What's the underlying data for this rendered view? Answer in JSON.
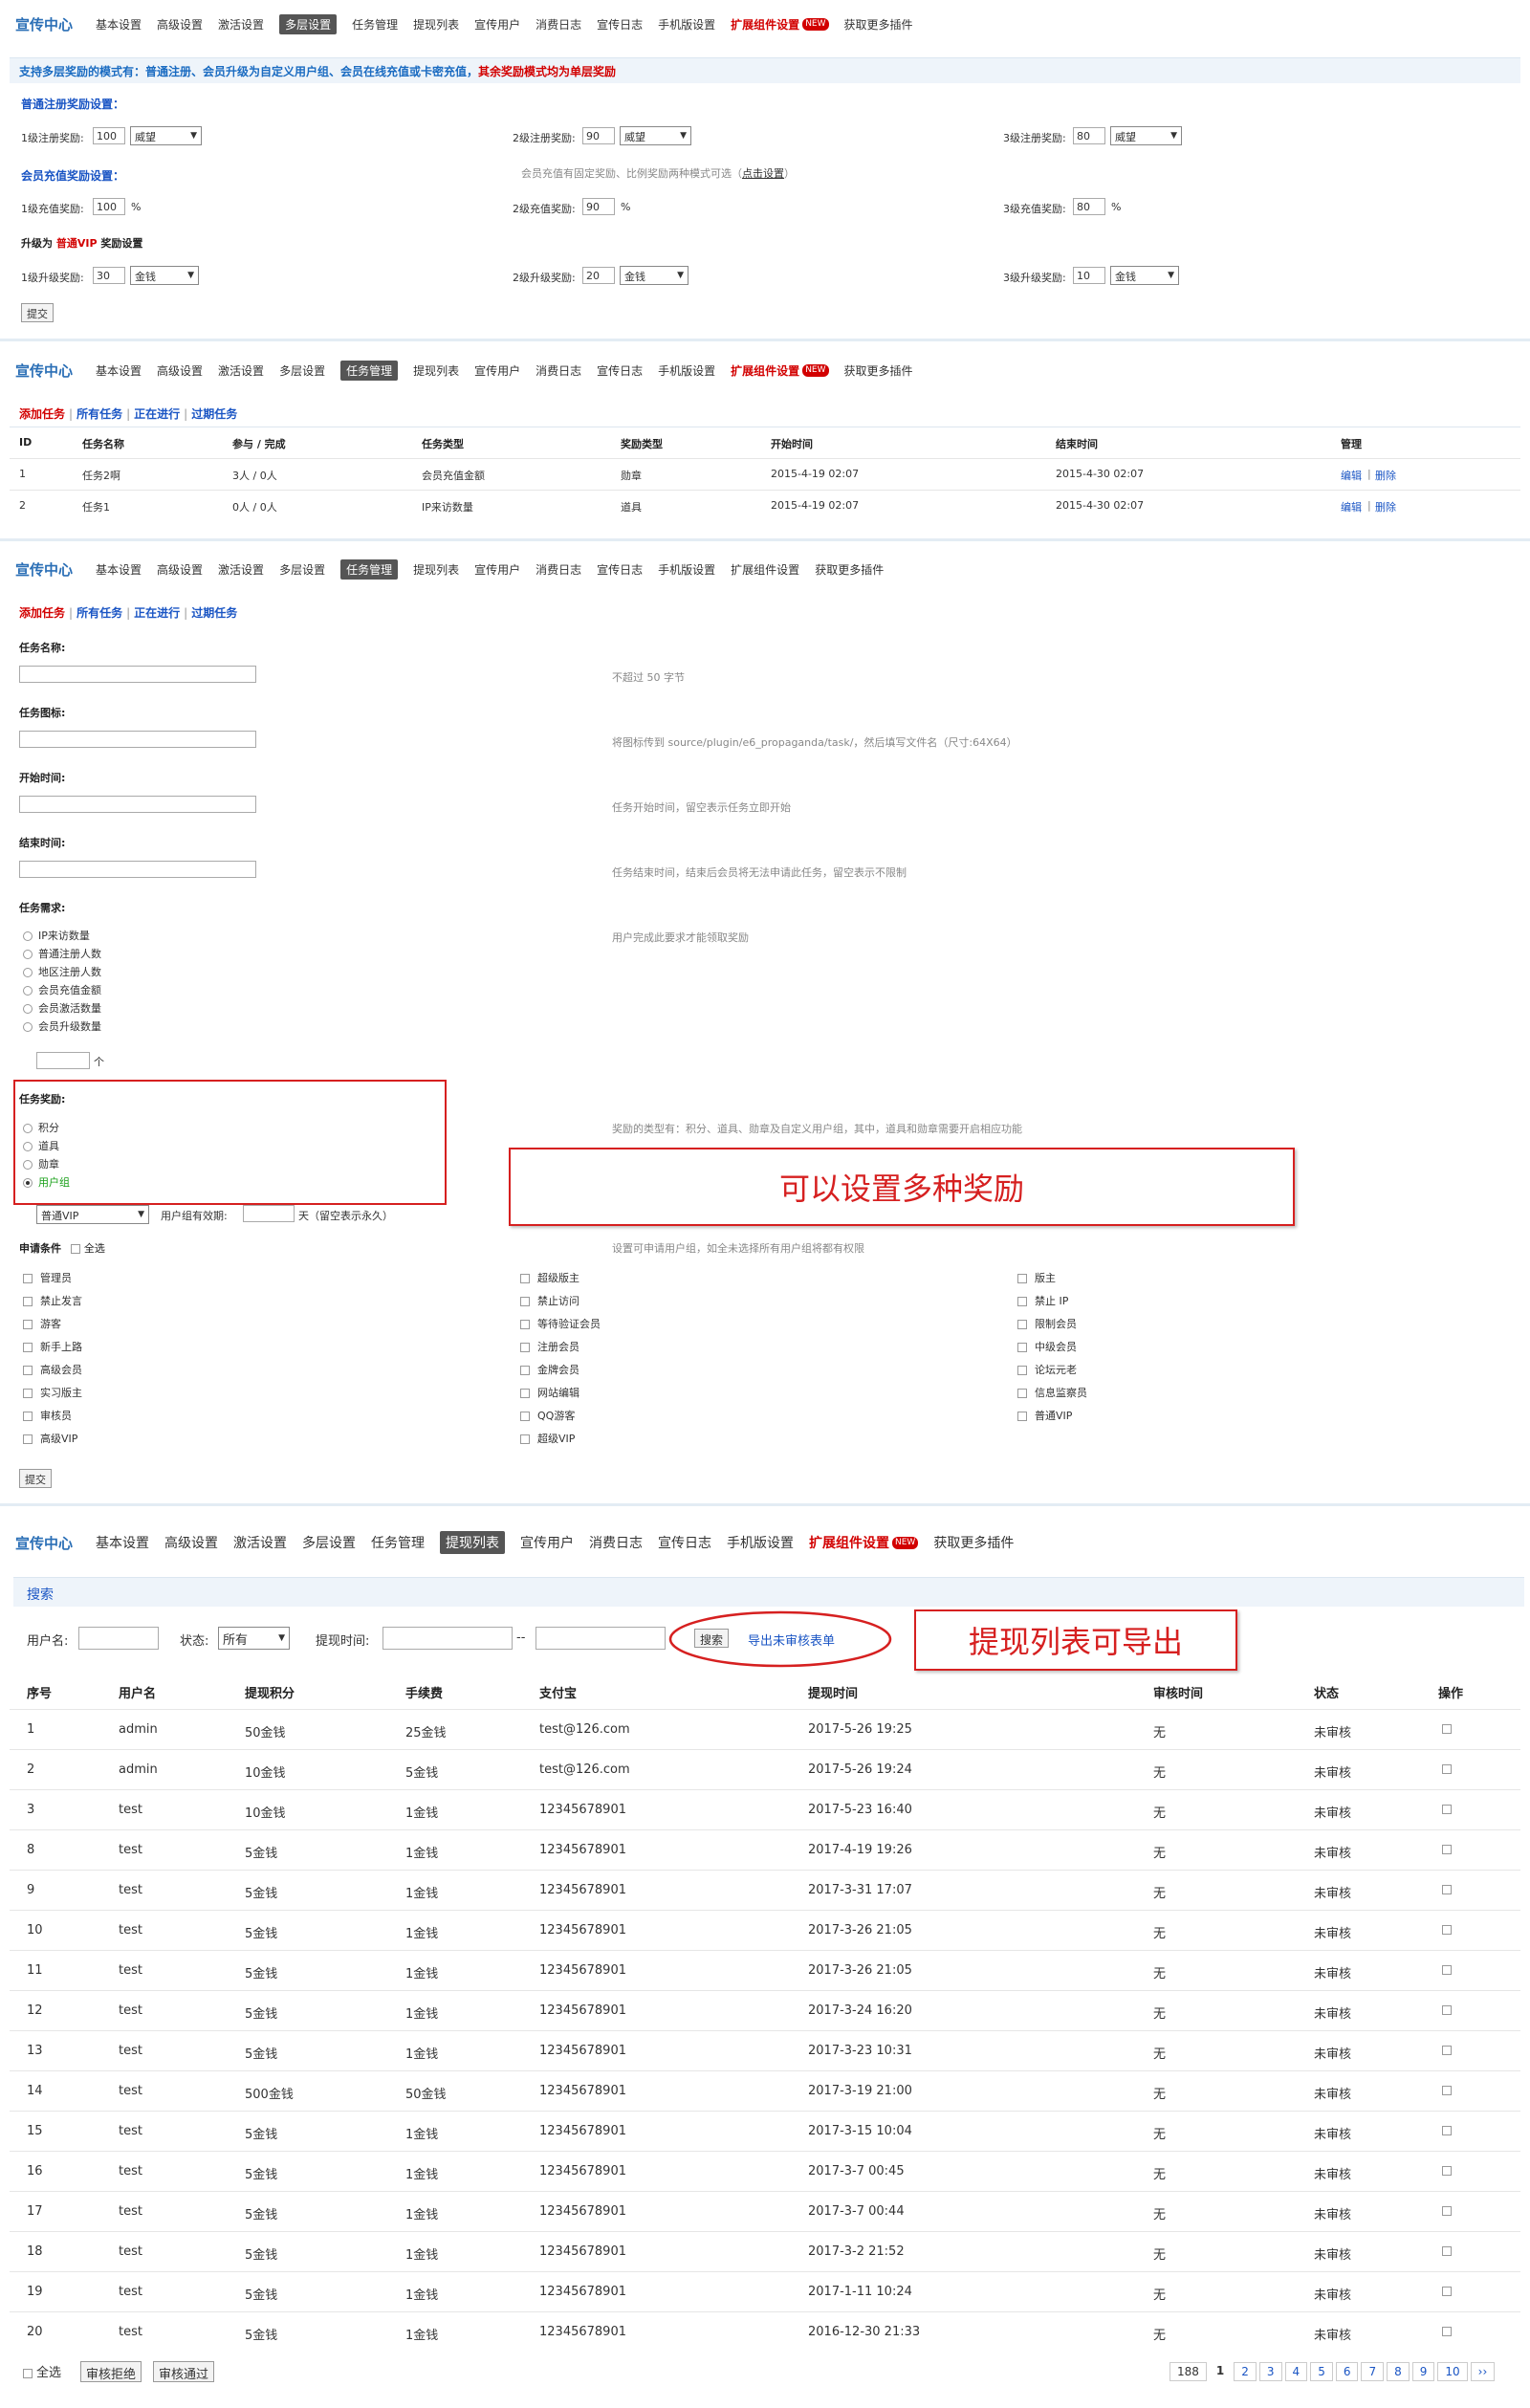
{
  "nav1": {
    "brand": "宣传中心",
    "items": [
      "基本设置",
      "高级设置",
      "激活设置",
      "多层设置",
      "任务管理",
      "提现列表",
      "宣传用户",
      "消费日志",
      "宣传日志",
      "手机版设置",
      "扩展组件设置",
      "获取更多插件"
    ],
    "hot": "NEW"
  },
  "multilayer": {
    "info_prefix": "支持多层奖励的模式有：普通注册、会员升级为自定义用户组、会员在线充值或卡密充值，",
    "info_suffix": "其余奖励模式均为单层奖励",
    "normal_title": "普通注册奖励设置：",
    "reg": [
      {
        "label": "1级注册奖励:",
        "value": "100",
        "unit": "威望"
      },
      {
        "label": "2级注册奖励:",
        "value": "90",
        "unit": "威望"
      },
      {
        "label": "3级注册奖励:",
        "value": "80",
        "unit": "威望"
      }
    ],
    "recharge_title": "会员充值奖励设置：",
    "recharge_note_a": "会员充值有固定奖励、比例奖励两种模式可选（",
    "recharge_note_link": "点击设置",
    "recharge_note_b": "）",
    "recharge": [
      {
        "label": "1级充值奖励:",
        "value": "100",
        "unit": "%"
      },
      {
        "label": "2级充值奖励:",
        "value": "90",
        "unit": "%"
      },
      {
        "label": "3级充值奖励:",
        "value": "80",
        "unit": "%"
      }
    ],
    "upgrade_a": "升级为",
    "upgrade_group": "普通VIP",
    "upgrade_b": "奖励设置",
    "upgrade": [
      {
        "label": "1级升级奖励:",
        "value": "30",
        "unit": "金钱"
      },
      {
        "label": "2级升级奖励:",
        "value": "20",
        "unit": "金钱"
      },
      {
        "label": "3级升级奖励:",
        "value": "10",
        "unit": "金钱"
      }
    ],
    "submit": "提交"
  },
  "tasks": {
    "tabs": [
      "添加任务",
      "所有任务",
      "正在进行",
      "过期任务"
    ],
    "headers": [
      "ID",
      "任务名称",
      "参与 / 完成",
      "任务类型",
      "奖励类型",
      "开始时间",
      "结束时间",
      "管理"
    ],
    "rows": [
      [
        "1",
        "任务2啊",
        "3人 / 0人",
        "会员充值金额",
        "勋章",
        "2015-4-19 02:07",
        "2015-4-30 02:07"
      ],
      [
        "2",
        "任务1",
        "0人 / 0人",
        "IP来访数量",
        "道具",
        "2015-4-19 02:07",
        "2015-4-30 02:07"
      ]
    ],
    "edit": "编辑",
    "delete": "删除",
    "sep": "|"
  },
  "form": {
    "name_label": "任务名称:",
    "name_hint": "不超过 50 字节",
    "icon_label": "任务图标:",
    "icon_hint": "将图标传到 source/plugin/e6_propaganda/task/，然后填写文件名（尺寸:64X64）",
    "start_label": "开始时间:",
    "start_hint": "任务开始时间，留空表示任务立即开始",
    "end_label": "结束时间:",
    "end_hint": "任务结束时间，结束后会员将无法申请此任务，留空表示不限制",
    "req_label": "任务需求:",
    "req_hint": "用户完成此要求才能领取奖励",
    "req_options": [
      "IP来访数量",
      "普通注册人数",
      "地区注册人数",
      "会员充值金额",
      "会员激活数量",
      "会员升级数量"
    ],
    "req_unit": "个",
    "reward_label": "任务奖励:",
    "reward_hint": "奖励的类型有：积分、道具、勋章及自定义用户组，其中，道具和勋章需要开启相应功能",
    "reward_options": [
      "积分",
      "道具",
      "勋章",
      "用户组"
    ],
    "reward_group": "普通VIP",
    "reward_valid_label": "用户组有效期:",
    "reward_valid_unit": "天（留空表示永久）",
    "apply_label": "申请条件",
    "apply_all": "全选",
    "apply_hint": "设置可申请用户组，如全未选择所有用户组将都有权限",
    "groups": [
      [
        "管理员",
        "超级版主",
        "版主"
      ],
      [
        "禁止发言",
        "禁止访问",
        "禁止 IP"
      ],
      [
        "游客",
        "等待验证会员",
        "限制会员"
      ],
      [
        "新手上路",
        "注册会员",
        "中级会员"
      ],
      [
        "高级会员",
        "金牌会员",
        "论坛元老"
      ],
      [
        "实习版主",
        "网站编辑",
        "信息监察员"
      ],
      [
        "审核员",
        "QQ游客",
        "普通VIP"
      ],
      [
        "高级VIP",
        "超级VIP",
        ""
      ]
    ],
    "submit": "提交",
    "annotation": "可以设置多种奖励"
  },
  "withdraw": {
    "search_title": "搜索",
    "username_label": "用户名:",
    "status_label": "状态:",
    "status_value": "所有",
    "time_label": "提现时间:",
    "time_sep": "--",
    "search_button": "搜索",
    "export_link": "导出未审核表单",
    "annotation": "提现列表可导出",
    "headers": [
      "序号",
      "用户名",
      "提现积分",
      "手续费",
      "支付宝",
      "提现时间",
      "审核时间",
      "状态",
      "操作"
    ],
    "rows": [
      [
        "1",
        "admin",
        "50金钱",
        "25金钱",
        "test@126.com",
        "2017-5-26 19:25",
        "无",
        "未审核"
      ],
      [
        "2",
        "admin",
        "10金钱",
        "5金钱",
        "test@126.com",
        "2017-5-26 19:24",
        "无",
        "未审核"
      ],
      [
        "3",
        "test",
        "10金钱",
        "1金钱",
        "12345678901",
        "2017-5-23 16:40",
        "无",
        "未审核"
      ],
      [
        "8",
        "test",
        "5金钱",
        "1金钱",
        "12345678901",
        "2017-4-19 19:26",
        "无",
        "未审核"
      ],
      [
        "9",
        "test",
        "5金钱",
        "1金钱",
        "12345678901",
        "2017-3-31 17:07",
        "无",
        "未审核"
      ],
      [
        "10",
        "test",
        "5金钱",
        "1金钱",
        "12345678901",
        "2017-3-26 21:05",
        "无",
        "未审核"
      ],
      [
        "11",
        "test",
        "5金钱",
        "1金钱",
        "12345678901",
        "2017-3-26 21:05",
        "无",
        "未审核"
      ],
      [
        "12",
        "test",
        "5金钱",
        "1金钱",
        "12345678901",
        "2017-3-24 16:20",
        "无",
        "未审核"
      ],
      [
        "13",
        "test",
        "5金钱",
        "1金钱",
        "12345678901",
        "2017-3-23 10:31",
        "无",
        "未审核"
      ],
      [
        "14",
        "test",
        "500金钱",
        "50金钱",
        "12345678901",
        "2017-3-19 21:00",
        "无",
        "未审核"
      ],
      [
        "15",
        "test",
        "5金钱",
        "1金钱",
        "12345678901",
        "2017-3-15 10:04",
        "无",
        "未审核"
      ],
      [
        "16",
        "test",
        "5金钱",
        "1金钱",
        "12345678901",
        "2017-3-7 00:45",
        "无",
        "未审核"
      ],
      [
        "17",
        "test",
        "5金钱",
        "1金钱",
        "12345678901",
        "2017-3-7 00:44",
        "无",
        "未审核"
      ],
      [
        "18",
        "test",
        "5金钱",
        "1金钱",
        "12345678901",
        "2017-3-2 21:52",
        "无",
        "未审核"
      ],
      [
        "19",
        "test",
        "5金钱",
        "1金钱",
        "12345678901",
        "2017-1-11 10:24",
        "无",
        "未审核"
      ],
      [
        "20",
        "test",
        "5金钱",
        "1金钱",
        "12345678901",
        "2016-12-30 21:33",
        "无",
        "未审核"
      ]
    ],
    "select_all": "全选",
    "reject": "审核拒绝",
    "approve": "审核通过",
    "pager_total": "188",
    "pages": [
      "1",
      "2",
      "3",
      "4",
      "5",
      "6",
      "7",
      "8",
      "9",
      "10",
      "››"
    ]
  }
}
